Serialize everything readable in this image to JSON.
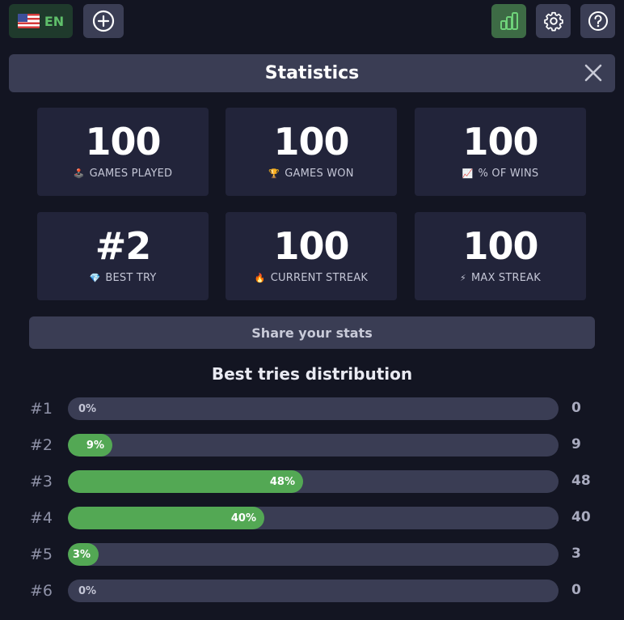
{
  "topbar": {
    "language_code": "EN",
    "icons": {
      "flag": "us-flag-icon",
      "add": "plus-circle-icon",
      "stats": "bar-chart-icon",
      "settings": "gear-icon",
      "help": "question-circle-icon"
    },
    "colors": {
      "accent_green": "#5fbf6a",
      "stats_button_bg": "#3d6b45"
    }
  },
  "header": {
    "title": "Statistics",
    "close_icon": "close-icon"
  },
  "stats": [
    {
      "value": "100",
      "label": "GAMES PLAYED",
      "emoji": "🕹️"
    },
    {
      "value": "100",
      "label": "GAMES WON",
      "emoji": "🏆"
    },
    {
      "value": "100",
      "label": "% OF WINS",
      "emoji": "📈"
    },
    {
      "value": "#2",
      "label": "BEST TRY",
      "emoji": "💎"
    },
    {
      "value": "100",
      "label": "CURRENT STREAK",
      "emoji": "🔥"
    },
    {
      "value": "100",
      "label": "MAX STREAK",
      "emoji": "⚡"
    }
  ],
  "share_label": "Share your stats",
  "distribution": {
    "title": "Best tries distribution",
    "bar_color": "#53a854",
    "rows": [
      {
        "label": "#1",
        "percent": 0,
        "percent_label": "0%",
        "count": "0"
      },
      {
        "label": "#2",
        "percent": 9,
        "percent_label": "9%",
        "count": "9"
      },
      {
        "label": "#3",
        "percent": 48,
        "percent_label": "48%",
        "count": "48"
      },
      {
        "label": "#4",
        "percent": 40,
        "percent_label": "40%",
        "count": "40"
      },
      {
        "label": "#5",
        "percent": 3,
        "percent_label": "3%",
        "count": "3"
      },
      {
        "label": "#6",
        "percent": 0,
        "percent_label": "0%",
        "count": "0"
      }
    ]
  }
}
